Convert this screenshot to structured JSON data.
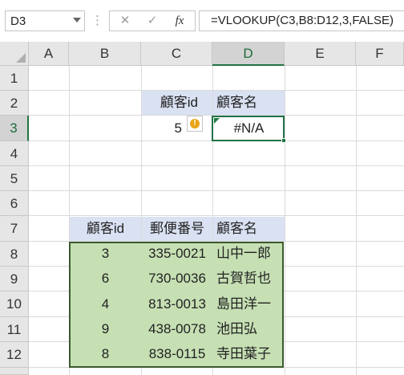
{
  "formula_bar": {
    "name_box": "D3",
    "cancel_icon": "✕",
    "enter_icon": "✓",
    "fx_label": "fx",
    "formula": "=VLOOKUP(C3,B8:D12,3,FALSE)"
  },
  "columns": [
    "A",
    "B",
    "C",
    "D",
    "E",
    "F"
  ],
  "rows": [
    "1",
    "2",
    "3",
    "4",
    "5",
    "6",
    "7",
    "8",
    "9",
    "10",
    "11",
    "12"
  ],
  "lookup": {
    "header_id": "顧客id",
    "header_name": "顧客名",
    "input_id": "5",
    "result": "#N/A",
    "warning_icon": "!"
  },
  "table": {
    "headers": [
      "顧客id",
      "郵便番号",
      "顧客名"
    ],
    "rows": [
      [
        "3",
        "335-0021",
        "山中一郎"
      ],
      [
        "6",
        "730-0036",
        "古賀哲也"
      ],
      [
        "4",
        "813-0013",
        "島田洋一"
      ],
      [
        "9",
        "438-0078",
        "池田弘"
      ],
      [
        "8",
        "838-0115",
        "寺田葉子"
      ]
    ]
  },
  "colors": {
    "header_fill": "#d9e1f2",
    "table_fill": "#c6e0b4",
    "selection": "#217346"
  }
}
